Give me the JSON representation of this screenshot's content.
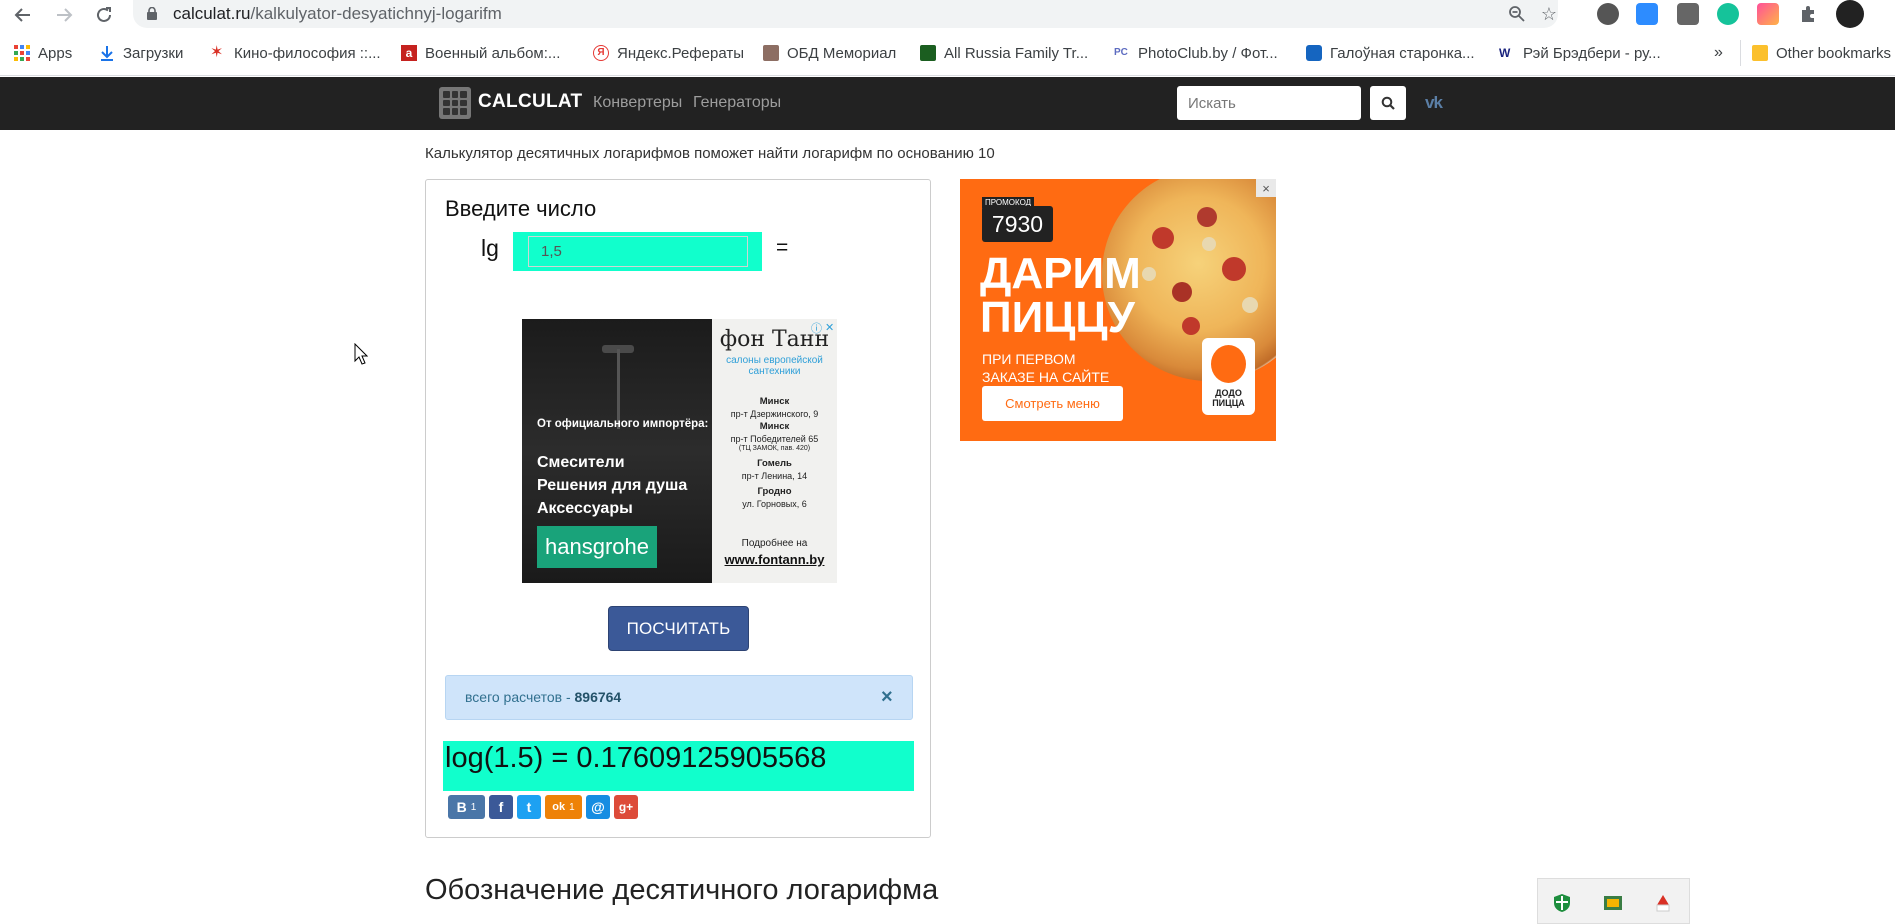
{
  "browser": {
    "url_host": "calculat.ru",
    "url_path": "/kalkulyator-desyatichnyj-logarifm",
    "bookmarks": [
      {
        "label": "Apps",
        "color": "#4285f4"
      },
      {
        "label": "Загрузки",
        "color": "#1a73e8"
      },
      {
        "label": "Кино-философия ::...",
        "color": "#d93025"
      },
      {
        "label": "Военный альбом:...",
        "color": "#c5221f"
      },
      {
        "label": "Яндекс.Рефераты",
        "color": "#e53935"
      },
      {
        "label": "ОБД Мемориал",
        "color": "#8d6e63"
      },
      {
        "label": "All Russia Family Tr...",
        "color": "#2e7d32"
      },
      {
        "label": "PhotoClub.by / Фот...",
        "color": "#5c6bc0"
      },
      {
        "label": "Галоўная старонка...",
        "color": "#1565c0"
      },
      {
        "label": "Рэй Брэдбери - ру...",
        "color": "#1a237e"
      }
    ],
    "more_bookmarks": "»",
    "other_bookmarks": "Other bookmarks"
  },
  "site": {
    "logo": "CALCULAT",
    "nav": [
      "Конвертеры",
      "Генераторы"
    ],
    "search_placeholder": "Искать",
    "vk": "vk"
  },
  "content": {
    "intro": "Калькулятор десятичных логарифмов поможет найти логарифм по основанию 10",
    "panel_title": "Введите число",
    "lg_label": "lg",
    "input_value": "1,5",
    "equals": "=",
    "calc_button": "ПОСЧИТАТЬ",
    "alert_prefix": "всего расчетов - ",
    "alert_count": "896764",
    "alert_close": "×",
    "result": "log(1.5) = 0.17609125905568",
    "share": [
      {
        "label": "В",
        "count": "1",
        "color": "#4a76a8"
      },
      {
        "label": "f",
        "count": "",
        "color": "#3b5998"
      },
      {
        "label": "t",
        "count": "",
        "color": "#1da1f2"
      },
      {
        "label": "ok",
        "count": "1",
        "color": "#ee8208"
      },
      {
        "label": "@",
        "count": "",
        "color": "#168de2"
      },
      {
        "label": "g+",
        "count": "",
        "color": "#dd4b39"
      }
    ],
    "section_title": "Обозначение десятичного логарифма"
  },
  "ad_middle": {
    "subtitle": "От официального импортёра:",
    "items": [
      "Смесители",
      "Решения для душа",
      "Аксессуары"
    ],
    "brand": "hansgrohe",
    "logo": "фон Танн",
    "tagline": "салоны европейской сантехники",
    "cities": [
      {
        "city": "Минск",
        "address": "пр-т Дзержинского, 9"
      },
      {
        "city": "Минск",
        "address": "пр-т Победителей 65"
      },
      {
        "city": "Гомель",
        "address": "пр-т Ленина, 14"
      },
      {
        "city": "Гродно",
        "address": "ул. Горновых, 6"
      }
    ],
    "note": "(ТЦ ЗАМОК, пав. 420)",
    "more": "Подробнее на",
    "url": "www.fontann.by"
  },
  "ad_right": {
    "promo_label": "ПРОМОКОД",
    "promo_code": "7930",
    "headline_1": "ДАРИМ",
    "headline_2": "ПИЦЦУ",
    "sub_1": "ПРИ ПЕРВОМ",
    "sub_2": "ЗАКАЗЕ НА САЙТЕ",
    "button": "Смотреть меню",
    "brand_1": "ДОДО",
    "brand_2": "ПИЦЦА",
    "close": "×"
  }
}
